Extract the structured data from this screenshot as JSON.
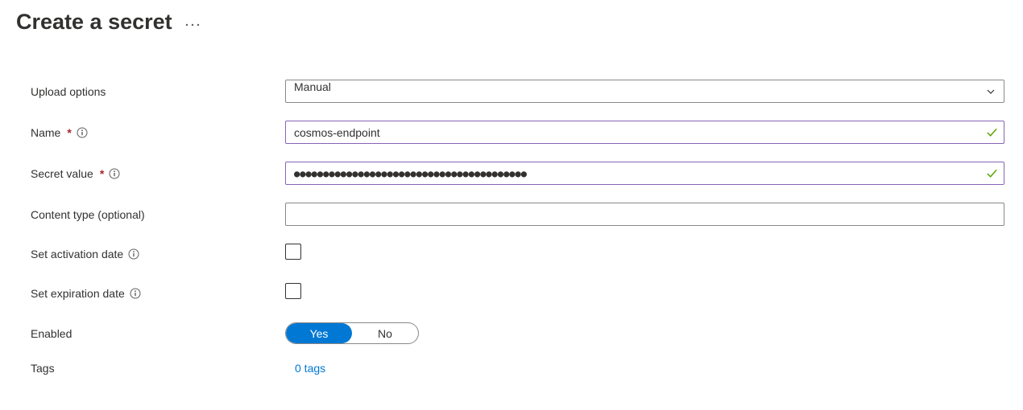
{
  "header": {
    "title": "Create a secret"
  },
  "form": {
    "upload_options": {
      "label": "Upload options",
      "value": "Manual"
    },
    "name": {
      "label": "Name",
      "value": "cosmos-endpoint",
      "required_mark": "*"
    },
    "secret_value": {
      "label": "Secret value",
      "value": "●●●●●●●●●●●●●●●●●●●●●●●●●●●●●●●●●●●●●●●●",
      "required_mark": "*"
    },
    "content_type": {
      "label": "Content type (optional)",
      "value": ""
    },
    "activation": {
      "label": "Set activation date",
      "checked": false
    },
    "expiration": {
      "label": "Set expiration date",
      "checked": false
    },
    "enabled": {
      "label": "Enabled",
      "yes": "Yes",
      "no": "No",
      "value": "Yes"
    },
    "tags": {
      "label": "Tags",
      "link": "0 tags"
    }
  }
}
